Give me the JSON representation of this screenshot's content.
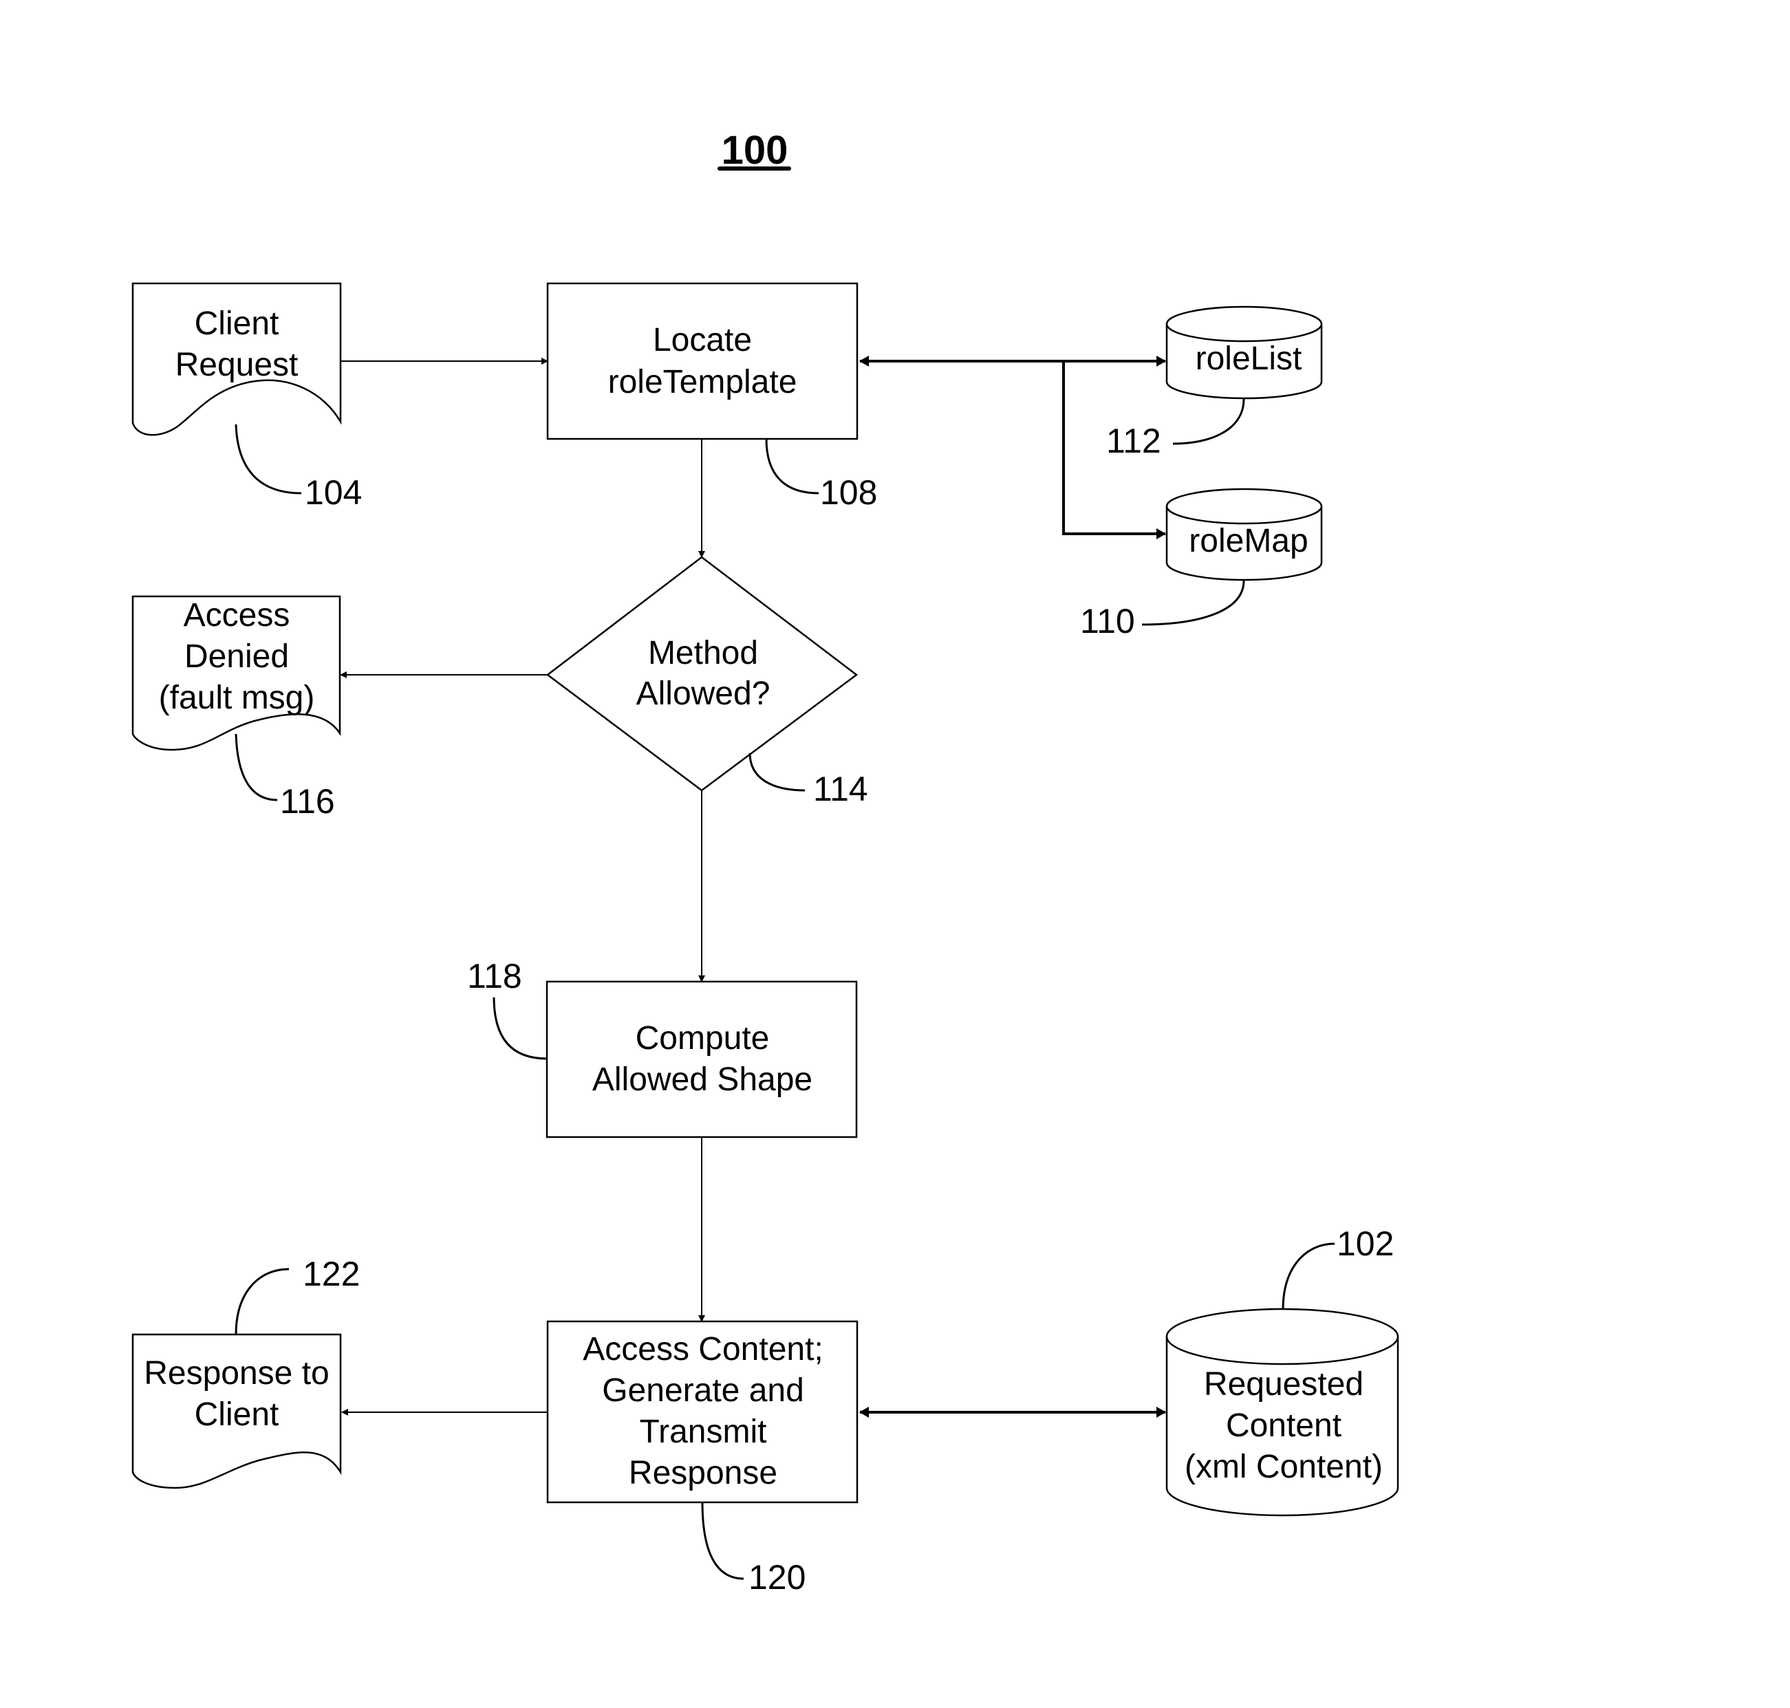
{
  "figure": {
    "title": "100"
  },
  "nodes": {
    "client_request": {
      "ref": "104",
      "type": "document",
      "lines": [
        "Client",
        "Request"
      ]
    },
    "locate_role_template": {
      "ref": "108",
      "type": "process",
      "lines": [
        "Locate",
        "roleTemplate"
      ]
    },
    "role_list": {
      "ref": "112",
      "type": "database",
      "lines": [
        "roleList"
      ]
    },
    "role_map": {
      "ref": "110",
      "type": "database",
      "lines": [
        "roleMap"
      ]
    },
    "method_allowed": {
      "ref": "114",
      "type": "decision",
      "lines": [
        "Method",
        "Allowed?"
      ]
    },
    "access_denied": {
      "ref": "116",
      "type": "document",
      "lines": [
        "Access",
        "Denied",
        "(fault msg)"
      ]
    },
    "compute_allowed_shape": {
      "ref": "118",
      "type": "process",
      "lines": [
        "Compute",
        "Allowed Shape"
      ]
    },
    "access_content": {
      "ref": "120",
      "type": "process",
      "lines": [
        "Access Content;",
        "Generate and",
        "Transmit",
        "Response"
      ]
    },
    "response_to_client": {
      "ref": "122",
      "type": "document",
      "lines": [
        "Response to",
        "Client"
      ]
    },
    "requested_content": {
      "ref": "102",
      "type": "database",
      "lines": [
        "Requested",
        "Content",
        "(xml Content)"
      ]
    }
  },
  "edges": [
    {
      "from": "client_request",
      "to": "locate_role_template",
      "direction": "forward"
    },
    {
      "from": "locate_role_template",
      "to": "role_list",
      "direction": "both"
    },
    {
      "from": "locate_role_template",
      "to": "role_map",
      "direction": "both"
    },
    {
      "from": "locate_role_template",
      "to": "method_allowed",
      "direction": "forward"
    },
    {
      "from": "method_allowed",
      "to": "access_denied",
      "direction": "forward"
    },
    {
      "from": "method_allowed",
      "to": "compute_allowed_shape",
      "direction": "forward"
    },
    {
      "from": "compute_allowed_shape",
      "to": "access_content",
      "direction": "forward"
    },
    {
      "from": "access_content",
      "to": "response_to_client",
      "direction": "forward"
    },
    {
      "from": "access_content",
      "to": "requested_content",
      "direction": "both"
    }
  ]
}
